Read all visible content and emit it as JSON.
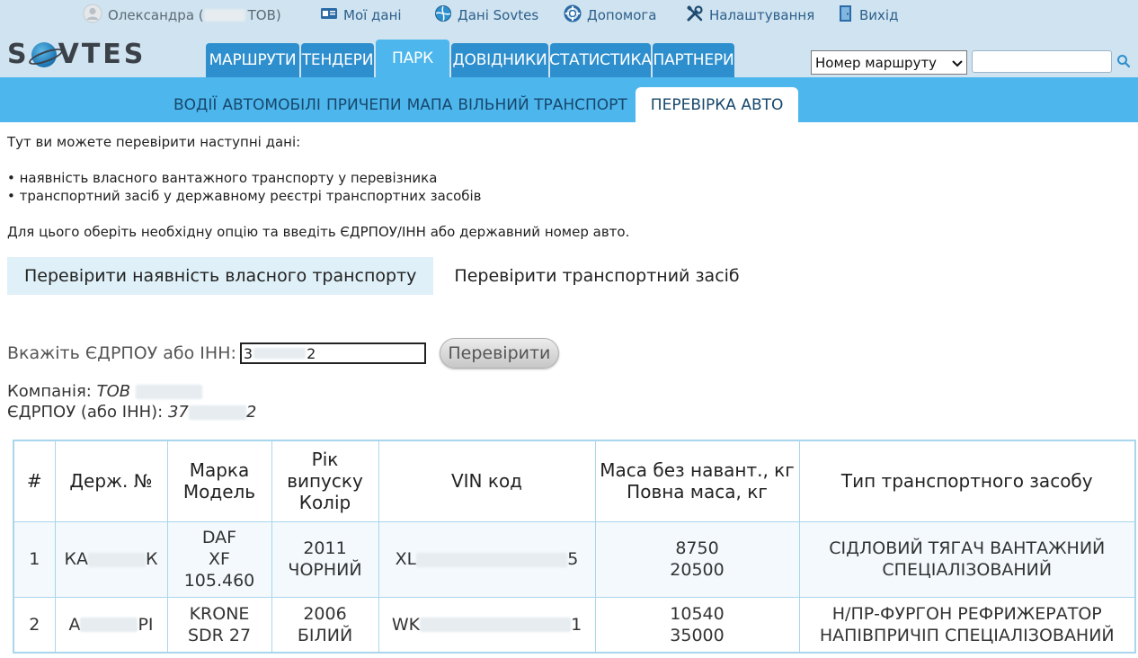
{
  "topbar": {
    "user_name": "Олександра (",
    "user_company_suffix": "ТОВ)",
    "links": [
      {
        "label": "Мої дані",
        "icon": "id-card-icon"
      },
      {
        "label": "Дані Sovtes",
        "icon": "globe-icon"
      },
      {
        "label": "Допомога",
        "icon": "lifebuoy-icon"
      },
      {
        "label": "Налаштування",
        "icon": "tools-icon"
      },
      {
        "label": "Вихід",
        "icon": "exit-door-icon"
      }
    ]
  },
  "logo": {
    "text_left": "S",
    "text_right": "VTES"
  },
  "nav": {
    "tabs": [
      "МАРШРУТИ",
      "ТЕНДЕРИ",
      "ПАРК",
      "ДОВІДНИКИ",
      "СТАТИСТИКА",
      "ПАРТНЕРИ"
    ],
    "active": "ПАРК"
  },
  "search": {
    "select_value": "Номер маршруту"
  },
  "subnav": {
    "items": [
      "ВОДІЇ",
      "АВТОМОБІЛІ",
      "ПРИЧЕПИ",
      "МАПА",
      "ВІЛЬНИЙ ТРАНСПОРТ",
      "ПЕРЕВІРКА АВТО"
    ],
    "active": "ПЕРЕВІРКА АВТО"
  },
  "intro": {
    "line1": "Тут ви можете перевірити наступні дані:",
    "bullet1": "• наявність власного вантажного транспорту у перевізника",
    "bullet2": "• транспортний засіб у державному реєстрі транспортних засобів",
    "line2": "Для цього оберіть необхідну опцію та введіть ЄДРПОУ/ІНН або державний номер авто."
  },
  "options": {
    "own_transport": "Перевірити наявність власного транспорту",
    "vehicle": "Перевірити транспортний засіб"
  },
  "form": {
    "label": "Вкажіть ЄДРПОУ або ІНН:",
    "value_start": "3",
    "value_end": "2",
    "button": "Перевірити"
  },
  "company": {
    "company_label": "Компанія:",
    "company_value": "ТОВ",
    "edrpou_label": "ЄДРПОУ (або ІНН):",
    "edrpou_start": "37",
    "edrpou_end": "2"
  },
  "table": {
    "headers": [
      "#",
      "Держ. №",
      "Марка\nМодель",
      "Рік\nвипуску\nКолір",
      "VIN код",
      "Маса без навант., кг\nПовна маса, кг",
      "Тип транспортного засобу"
    ],
    "rows": [
      {
        "num": "1",
        "plate_start": "КА",
        "plate_end": "К",
        "mark": "DAF\nXF\n105.460",
        "year": "2011\nЧОРНИЙ",
        "vin_start": "XL",
        "vin_end": "5",
        "mass": "8750\n20500",
        "type": "СІДЛОВИЙ ТЯГАЧ ВАНТАЖНИЙ\nСПЕЦІАЛІЗОВАНИЙ"
      },
      {
        "num": "2",
        "plate_start": "А",
        "plate_end": "РІ",
        "mark": "KRONE\nSDR 27",
        "year": "2006\nБІЛИЙ",
        "vin_start": "WK",
        "vin_end": "1",
        "mass": "10540\n35000",
        "type": "Н/ПР-ФУРГОН РЕФРИЖЕРАТОР\nНАПІВПРИЧІП СПЕЦІАЛІЗОВАНИЙ"
      }
    ]
  }
}
